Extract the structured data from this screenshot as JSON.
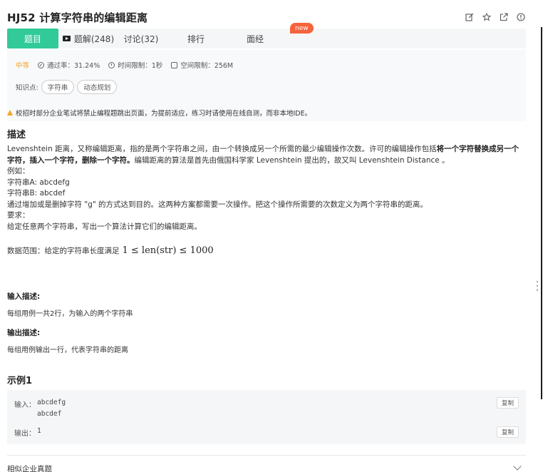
{
  "header": {
    "title": "HJ52  计算字符串的编辑距离",
    "icons": [
      "edit-icon",
      "star-icon",
      "share-icon",
      "info-icon"
    ]
  },
  "tabs": {
    "items": [
      {
        "label": "题目"
      },
      {
        "label": "题解(248)"
      },
      {
        "label": "讨论(32)"
      },
      {
        "label": "排行"
      },
      {
        "label": "面经"
      }
    ],
    "new_badge": "new"
  },
  "meta": {
    "difficulty": "中等",
    "pass_rate": "通过率：31.24%",
    "time_limit": "时间限制：1秒",
    "space_limit": "空间限制：256M",
    "knowledge_label": "知识点:",
    "tags": [
      "字符串",
      "动态规划"
    ]
  },
  "warning": "校招时部分企业笔试将禁止编程题跳出页面，为提前适应，练习时请使用在线自测，而非本地IDE。",
  "description": {
    "heading": "描述",
    "p1_a": "Levenshtein 距离，又称编辑距离，指的是两个字符串之间，由一个转换成另一个所需的最少编辑操作次数。许可的编辑操作包括",
    "p1_b": "将一个字符替换成另一个字符，插入一个字符，删除一个字符。",
    "p1_c": "编辑距离的算法是首先由俄国科学家 Levenshtein 提出的，故又叫 Levenshtein Distance 。",
    "l1": "例如：",
    "l2": "字符串A: abcdefg",
    "l3": "字符串B: abcdef",
    "l4": "通过增加或是删掉字符 \"g\" 的方式达到目的。这两种方案都需要一次操作。把这个操作所需要的次数定义为两个字符串的距离。",
    "l5": "要求：",
    "l6": "给定任意两个字符串，写出一个算法计算它们的编辑距离。",
    "range_label": "数据范围：给定的字符串长度满足",
    "range_math": "1 ≤ len(str) ≤ 1000"
  },
  "input_desc": {
    "heading": "输入描述:",
    "text": "每组用例一共2行，为输入的两个字符串"
  },
  "output_desc": {
    "heading": "输出描述:",
    "text": "每组用例输出一行，代表字符串的距离"
  },
  "example": {
    "heading": "示例1",
    "input_label": "输入：",
    "input_line1": "abcdefg",
    "input_line2": "abcdef",
    "output_label": "输出：",
    "output_value": "1",
    "copy_label": "复制"
  },
  "similar": {
    "label": "相似企业真题"
  }
}
